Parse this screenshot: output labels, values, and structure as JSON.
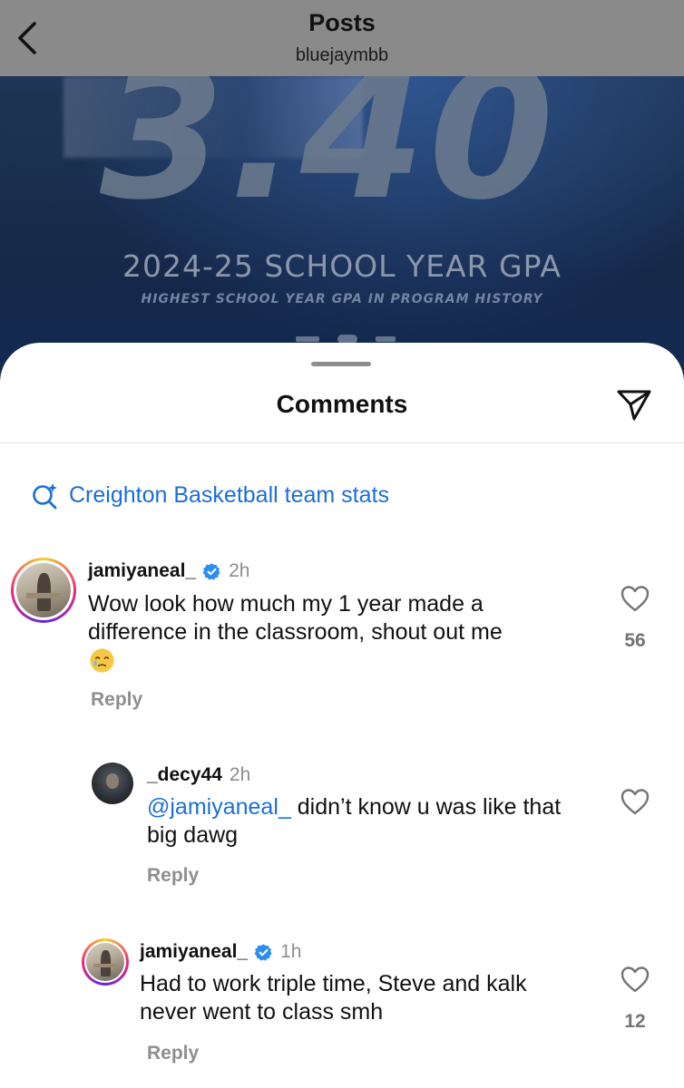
{
  "header": {
    "title": "Posts",
    "username": "bluejaymbb"
  },
  "post_image": {
    "big_number": "3.40",
    "headline": "2024-25 SCHOOL YEAR GPA",
    "subline": "HIGHEST SCHOOL YEAR GPA IN PROGRAM HISTORY"
  },
  "sheet": {
    "title": "Comments",
    "search_suggestion": "Creighton Basketball team stats"
  },
  "comments": [
    {
      "username": "jamiyaneal_",
      "verified": true,
      "time": "2h",
      "text": "Wow look how much my 1 year made a difference in the classroom, shout out me",
      "emoji": "face-holding-back-tears-emoji",
      "reply_label": "Reply",
      "like_count": "56"
    },
    {
      "username": "_decy44",
      "verified": false,
      "time": "2h",
      "mention": "@jamiyaneal_",
      "text": " didn’t know u was like that big dawg",
      "reply_label": "Reply",
      "like_count": ""
    },
    {
      "username": "jamiyaneal_",
      "verified": true,
      "time": "1h",
      "text": "Had to work triple time, Steve and kalk never went to class smh",
      "reply_label": "Reply",
      "like_count": "12"
    }
  ],
  "colors": {
    "link_blue": "#1c6ed8",
    "verified_blue": "#2b8ef2",
    "muted_gray": "#8e8e8e",
    "header_gray": "#8a8a8a"
  },
  "icons": {
    "back": "chevron-left-icon",
    "share": "paper-plane-icon",
    "search": "sparkle-search-icon",
    "like": "heart-outline-icon",
    "verified": "verified-badge-icon"
  }
}
